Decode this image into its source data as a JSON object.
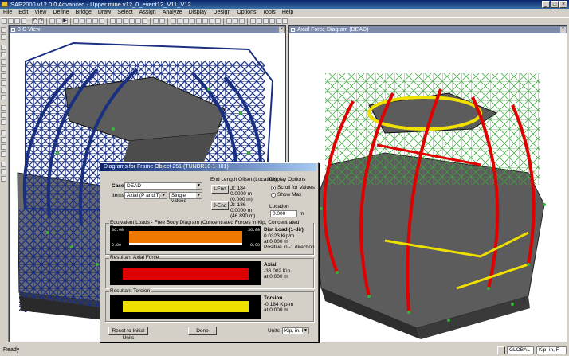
{
  "app": {
    "title": "SAP2000 v12.0.0 Advanced  - Upper mine v12_0_event12_V11_V12"
  },
  "menu": [
    "File",
    "Edit",
    "View",
    "Define",
    "Bridge",
    "Draw",
    "Select",
    "Assign",
    "Analyze",
    "Display",
    "Design",
    "Options",
    "Tools",
    "Help"
  ],
  "left_pane": {
    "title": "3-D View"
  },
  "right_pane": {
    "title": "Axial Force Diagram  (DEAD)"
  },
  "colors": {
    "structure": "#1a2f80",
    "deck": "#5a5a5a",
    "axial": "#e00000",
    "torsion": "#f0e000",
    "load": "#f07800",
    "wire": "#3aa83a"
  },
  "dialog": {
    "title": "Diagrams for Frame Object 251  (TUNBR10-1-II01)",
    "case_label": "Case",
    "case_value": "DEAD",
    "items_label": "Items",
    "items_value": "Axial (P and T)",
    "valued_value": "Single valued",
    "end_offset": {
      "title": "End Length Offset (Location)",
      "iend_btn": "I-End",
      "iend_jt": "Jt: 184",
      "iend_val1": "0.0000 m",
      "iend_val2": "(0.000 m)",
      "jend_btn": "J-End",
      "jend_jt": "Jt: 186",
      "jend_val1": "0.0000 m",
      "jend_val2": "(46.890 m)"
    },
    "display_options": {
      "title": "Display Options",
      "opt1": "Scroll for Values",
      "opt2": "Show Max"
    },
    "location": {
      "title": "Location",
      "value": "0.000",
      "unit": "m"
    },
    "equiv": {
      "title": "Equivalent Loads - Free Body Diagram  (Concentrated Forces in Kip, Concentrated Torsions in Kip-m)",
      "left_top": "36.00",
      "left_bottom": "0.00",
      "right_top": "36.00",
      "right_bottom": "0.00",
      "heading": "Dist Load (1-dir)",
      "line1": "0.0323 Kip/m",
      "line2": "at 0.000 m",
      "line3": "Positive in -1 direction"
    },
    "axial": {
      "title": "Resultant Axial Force",
      "heading": "Axial",
      "line1": "-36.002 Kip",
      "line2": "at 0.000 m"
    },
    "torsion": {
      "title": "Resultant Torsion",
      "heading": "Torsion",
      "line1": "-0.184 Kip-m",
      "line2": "at 0.000 m"
    },
    "reset_btn": "Reset to Initial Units",
    "done_btn": "Done",
    "units_label": "Units",
    "units_value": "Kip, in, F"
  },
  "status": {
    "ready": "Ready",
    "coord": "GLOBAL",
    "units": "Kip, in, F"
  }
}
